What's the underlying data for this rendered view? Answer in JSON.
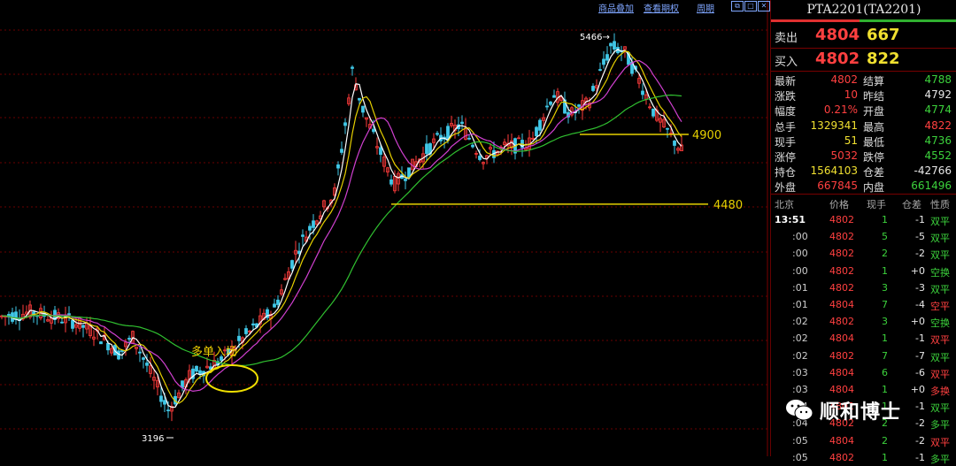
{
  "toolbar": {
    "links": [
      "商品叠加",
      "查看期权",
      "周期"
    ]
  },
  "chart_data": {
    "type": "candlestick",
    "annotations": {
      "high_label": "5466",
      "low_label": "3196",
      "entry_label": "多单入场",
      "level_4900": "4900",
      "level_4480": "4480"
    },
    "ylim": [
      3100,
      5550
    ],
    "levels": [
      4900,
      4480
    ],
    "high": 5466,
    "low": 3196,
    "ma_colors": {
      "white": "#ffffff",
      "yellow": "#e6d000",
      "magenta": "#d040d0",
      "green": "#30c030"
    },
    "candle_up": "#ff3b3b",
    "candle_down": "#40c8e8"
  },
  "panel": {
    "title": "PTA2201(TA2201)",
    "sell_label": "卖出",
    "sell_price": "4804",
    "sell_vol": "667",
    "buy_label": "买入",
    "buy_price": "4802",
    "buy_vol": "822",
    "stats": [
      {
        "l1": "最新",
        "v1": "4802",
        "c1": "red",
        "l2": "结算",
        "v2": "4788",
        "c2": "green"
      },
      {
        "l1": "涨跌",
        "v1": "10",
        "c1": "red",
        "l2": "昨结",
        "v2": "4792",
        "c2": "white"
      },
      {
        "l1": "幅度",
        "v1": "0.21%",
        "c1": "red",
        "l2": "开盘",
        "v2": "4774",
        "c2": "green"
      },
      {
        "l1": "总手",
        "v1": "1329341",
        "c1": "yellow",
        "l2": "最高",
        "v2": "4822",
        "c2": "red"
      },
      {
        "l1": "现手",
        "v1": "51",
        "c1": "yellow",
        "l2": "最低",
        "v2": "4736",
        "c2": "green"
      },
      {
        "l1": "涨停",
        "v1": "5032",
        "c1": "red",
        "l2": "跌停",
        "v2": "4552",
        "c2": "green"
      },
      {
        "l1": "持仓",
        "v1": "1564103",
        "c1": "yellow",
        "l2": "仓差",
        "v2": "-42766",
        "c2": "white"
      },
      {
        "l1": "外盘",
        "v1": "667845",
        "c1": "red",
        "l2": "内盘",
        "v2": "661496",
        "c2": "green"
      }
    ],
    "tick_headers": [
      "北京",
      "价格",
      "现手",
      "仓差",
      "性质"
    ],
    "ticks": [
      {
        "time": "13:51",
        "price": "4802",
        "pc": "red",
        "vol": "1",
        "diff": "-1",
        "type": "双平",
        "tc": "green"
      },
      {
        "time": ":00",
        "price": "4802",
        "pc": "red",
        "vol": "5",
        "diff": "-5",
        "type": "双平",
        "tc": "green"
      },
      {
        "time": ":00",
        "price": "4802",
        "pc": "red",
        "vol": "2",
        "diff": "-2",
        "type": "双平",
        "tc": "green"
      },
      {
        "time": ":00",
        "price": "4802",
        "pc": "red",
        "vol": "1",
        "diff": "+0",
        "type": "空换",
        "tc": "green"
      },
      {
        "time": ":01",
        "price": "4802",
        "pc": "red",
        "vol": "3",
        "diff": "-3",
        "type": "双平",
        "tc": "green"
      },
      {
        "time": ":01",
        "price": "4804",
        "pc": "red",
        "vol": "7",
        "diff": "-4",
        "type": "空平",
        "tc": "red"
      },
      {
        "time": ":02",
        "price": "4802",
        "pc": "red",
        "vol": "3",
        "diff": "+0",
        "type": "空换",
        "tc": "green"
      },
      {
        "time": ":02",
        "price": "4804",
        "pc": "red",
        "vol": "1",
        "diff": "-1",
        "type": "双平",
        "tc": "red"
      },
      {
        "time": ":02",
        "price": "4802",
        "pc": "red",
        "vol": "7",
        "diff": "-7",
        "type": "双平",
        "tc": "green"
      },
      {
        "time": ":03",
        "price": "4804",
        "pc": "red",
        "vol": "6",
        "diff": "-6",
        "type": "双平",
        "tc": "red"
      },
      {
        "time": ":03",
        "price": "4804",
        "pc": "red",
        "vol": "1",
        "diff": "+0",
        "type": "多换",
        "tc": "red"
      },
      {
        "time": ":04",
        "price": "4802",
        "pc": "red",
        "vol": "1",
        "diff": "-1",
        "type": "双平",
        "tc": "green"
      },
      {
        "time": ":04",
        "price": "4802",
        "pc": "red",
        "vol": "2",
        "diff": "-2",
        "type": "多平",
        "tc": "green"
      },
      {
        "time": ":05",
        "price": "4804",
        "pc": "red",
        "vol": "2",
        "diff": "-2",
        "type": "双平",
        "tc": "red"
      },
      {
        "time": ":05",
        "price": "4802",
        "pc": "red",
        "vol": "1",
        "diff": "-1",
        "type": "多平",
        "tc": "green"
      }
    ]
  },
  "watermark": {
    "text": "顺和博士"
  }
}
